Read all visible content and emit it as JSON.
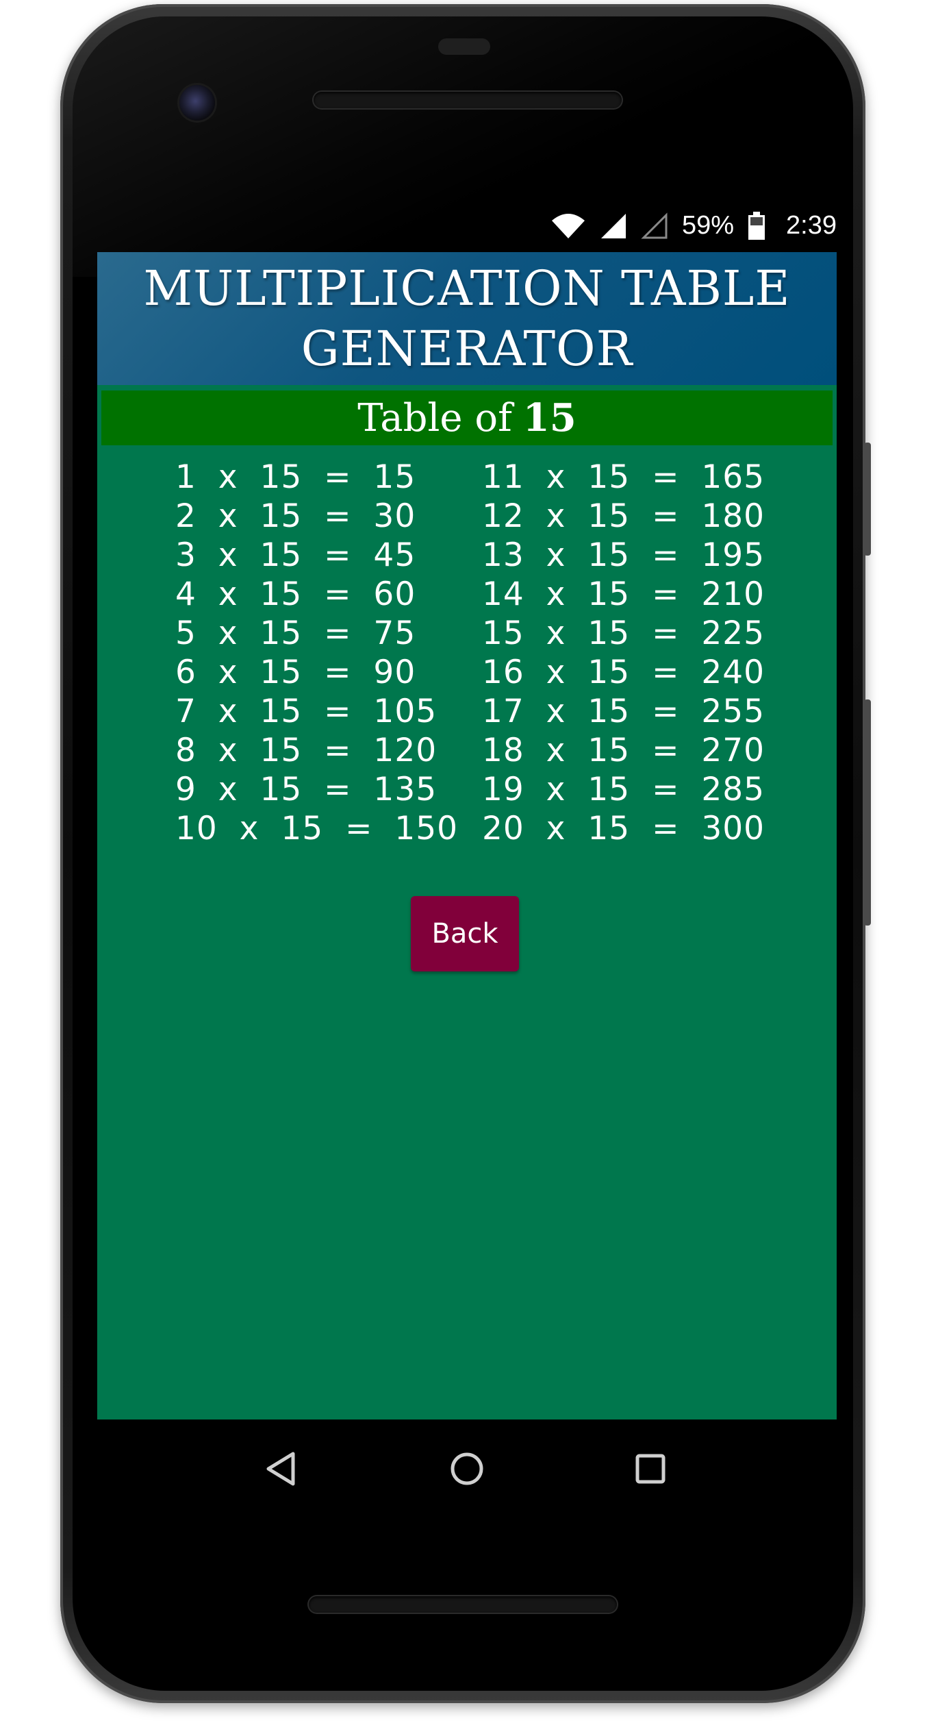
{
  "status_bar": {
    "battery_percent": "59%",
    "time": "2:39",
    "icons": [
      "wifi-icon",
      "cell-signal-icon",
      "cell-signal-empty-icon",
      "battery-icon"
    ]
  },
  "app": {
    "title_line1": "MULTIPLICATION TABLE",
    "title_line2": "GENERATOR",
    "subtitle_prefix": "Table of",
    "subtitle_number": "15",
    "colors": {
      "header": "#004f7b",
      "subheader": "#007200",
      "background": "#00774d",
      "back_button": "#81003a"
    }
  },
  "table": {
    "left": [
      "1  x  15  =  15",
      "2  x  15  =  30",
      "3  x  15  =  45",
      "4  x  15  =  60",
      "5  x  15  =  75",
      "6  x  15  =  90",
      "7  x  15  =  105",
      "8  x  15  =  120",
      "9  x  15  =  135",
      "10  x  15  =  150"
    ],
    "right": [
      "11  x  15  =  165",
      "12  x  15  =  180",
      "13  x  15  =  195",
      "14  x  15  =  210",
      "15  x  15  =  225",
      "16  x  15  =  240",
      "17  x  15  =  255",
      "18  x  15  =  270",
      "19  x  15  =  285",
      "20  x  15  =  300"
    ]
  },
  "buttons": {
    "back_label": "Back"
  },
  "nav_bar": {
    "icons": [
      "nav-back-icon",
      "nav-home-icon",
      "nav-recents-icon"
    ]
  }
}
